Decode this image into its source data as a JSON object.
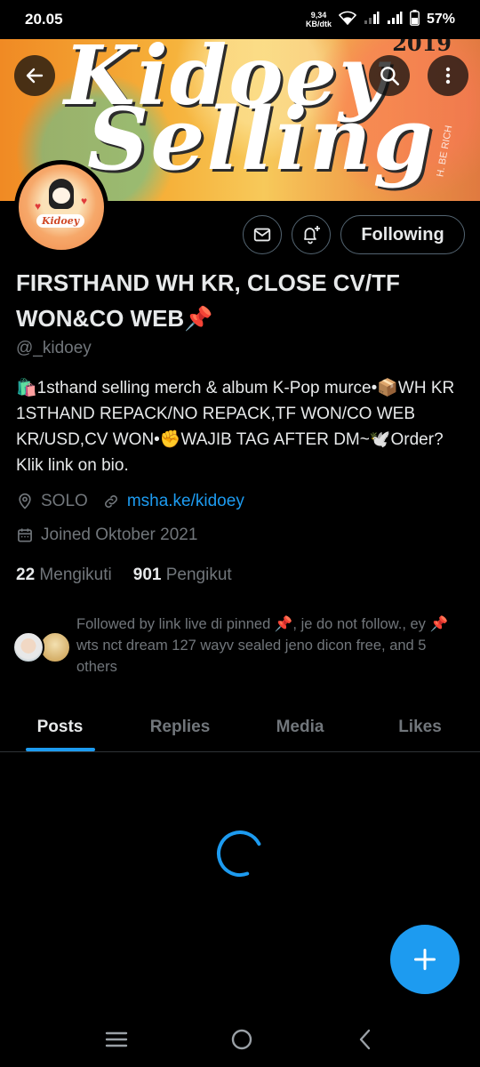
{
  "status_bar": {
    "time": "20.05",
    "net_speed": "9,34",
    "net_unit": "KB/dtk",
    "battery": "57%"
  },
  "banner": {
    "line1": "Kidoey",
    "line2": "Selling",
    "year": "2019",
    "side_text": "H. BE RICH"
  },
  "avatar": {
    "label": "Kidoey"
  },
  "profile": {
    "follow_state": "Following",
    "name": "FIRSTHAND WH KR, CLOSE CV/TF WON&CO WEB📌",
    "handle": "@_kidoey",
    "bio": "🛍️1sthand selling merch & album K-Pop murce•📦WH KR 1STHAND REPACK/NO REPACK,TF WON/CO WEB KR/USD,CV WON•✊WAJIB TAG AFTER DM~🕊️Order? Klik link on bio.",
    "location": "SOLO",
    "link": "msha.ke/kidoey",
    "joined": "Joined Oktober 2021",
    "following_count": "22",
    "following_label": "Mengikuti",
    "followers_count": "901",
    "followers_label": "Pengikut",
    "followed_by": "Followed by link live di pinned 📌, je do not follow., ey 📌wts nct dream 127 wayv sealed jeno dicon free, and 5 others"
  },
  "tabs": [
    "Posts",
    "Replies",
    "Media",
    "Likes"
  ],
  "colors": {
    "accent": "#1d9bf0",
    "muted": "#71767b",
    "text": "#e7e9ea",
    "divider": "#2f3336"
  },
  "icons": {
    "back": "arrow-left-icon",
    "search": "search-icon",
    "more": "more-vertical-icon",
    "message": "envelope-icon",
    "notify": "bell-plus-icon",
    "location": "location-pin-icon",
    "link": "link-icon",
    "calendar": "calendar-icon",
    "compose": "plus-icon",
    "nav_recent": "menu-lines-icon",
    "nav_home": "circle-home-icon",
    "nav_back": "chevron-left-icon"
  }
}
